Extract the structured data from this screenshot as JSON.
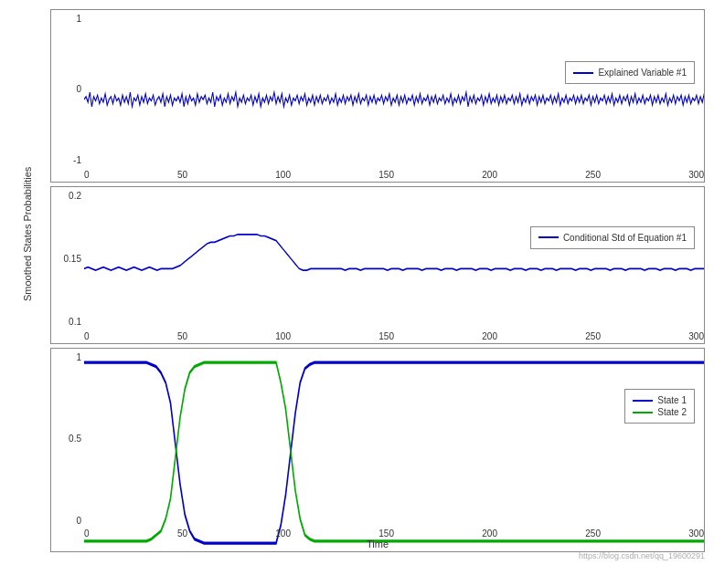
{
  "charts": [
    {
      "id": "chart1",
      "yTicks": [
        "1",
        "0",
        "-1"
      ],
      "xTicks": [
        "0",
        "50",
        "100",
        "150",
        "200",
        "250",
        "300"
      ],
      "legend": [
        {
          "label": "Explained Variable #1",
          "color": "#0000cc"
        }
      ],
      "legendTop": "30%"
    },
    {
      "id": "chart2",
      "yTicks": [
        "0.2",
        "0.15",
        "0.1"
      ],
      "xTicks": [
        "0",
        "50",
        "100",
        "150",
        "200",
        "250",
        "300"
      ],
      "legend": [
        {
          "label": "Conditional Std of Equation #1",
          "color": "#0000cc"
        }
      ],
      "legendTop": "30%"
    },
    {
      "id": "chart3",
      "yTicks": [
        "1",
        "0.5",
        "0"
      ],
      "xTicks": [
        "0",
        "50",
        "100",
        "150",
        "200",
        "250",
        "300"
      ],
      "legend": [
        {
          "label": "State 1",
          "color": "#0000cc"
        },
        {
          "label": "State 2",
          "color": "#00aa00"
        }
      ],
      "legendTop": "25%"
    }
  ],
  "yAxisLabel": "Smoothed States Probabilities",
  "xAxisLabel": "Time",
  "watermark": "https://blog.csdn.net/qq_19600291"
}
